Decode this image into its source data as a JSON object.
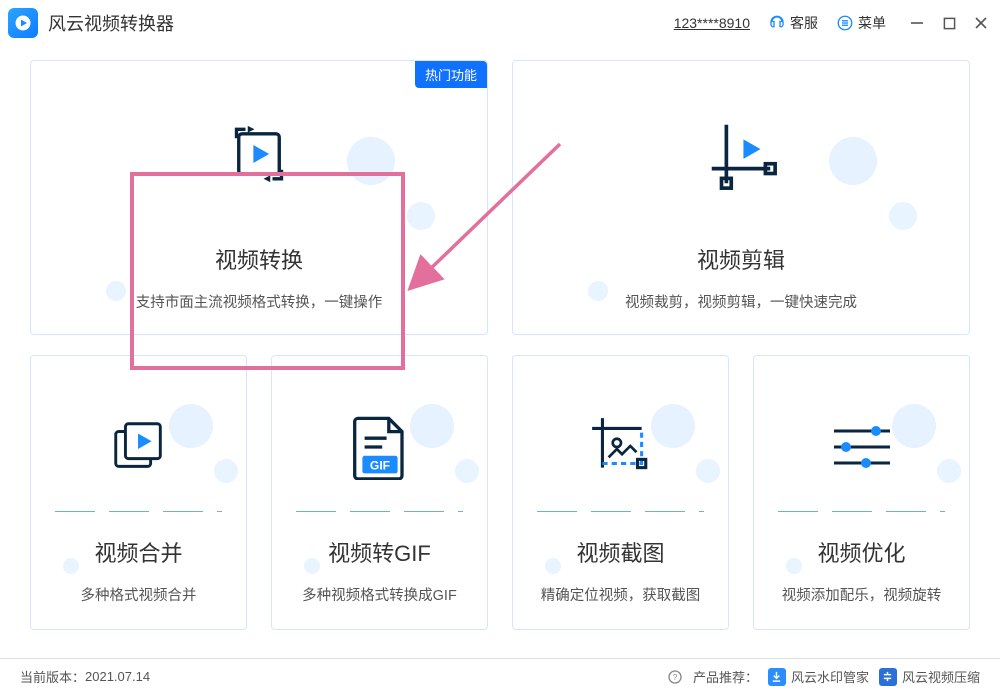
{
  "app": {
    "title": "风云视频转换器"
  },
  "header": {
    "user_id": "123****8910",
    "support_label": "客服",
    "menu_label": "菜单"
  },
  "cards": {
    "convert": {
      "badge": "热门功能",
      "title": "视频转换",
      "desc": "支持市面主流视频格式转换，一键操作"
    },
    "edit": {
      "title": "视频剪辑",
      "desc": "视频裁剪，视频剪辑，一键快速完成"
    },
    "merge": {
      "title": "视频合并",
      "desc": "多种格式视频合并"
    },
    "gif": {
      "title": "视频转GIF",
      "icon_label": "GIF",
      "desc": "多种视频格式转换成GIF"
    },
    "screenshot": {
      "title": "视频截图",
      "desc": "精确定位视频，获取截图"
    },
    "optimize": {
      "title": "视频优化",
      "desc": "视频添加配乐，视频旋转"
    }
  },
  "footer": {
    "version_label": "当前版本：",
    "version_value": "2021.07.14",
    "recommend_label": "产品推荐：",
    "rec1": "风云水印管家",
    "rec2": "风云视频压缩"
  }
}
